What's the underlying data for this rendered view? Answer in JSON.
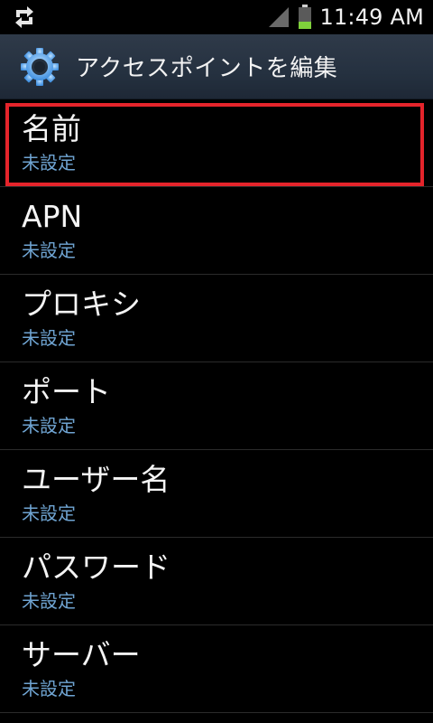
{
  "status_bar": {
    "time": "11:49 AM",
    "sync_icon": "sync-icon",
    "signal_icon": "signal-icon",
    "battery_icon": "battery-icon"
  },
  "header": {
    "icon": "settings-icon",
    "title": "アクセスポイントを編集"
  },
  "preferences": [
    {
      "title": "名前",
      "summary": "未設定"
    },
    {
      "title": "APN",
      "summary": "未設定"
    },
    {
      "title": "プロキシ",
      "summary": "未設定"
    },
    {
      "title": "ポート",
      "summary": "未設定"
    },
    {
      "title": "ユーザー名",
      "summary": "未設定"
    },
    {
      "title": "パスワード",
      "summary": "未設定"
    },
    {
      "title": "サーバー",
      "summary": "未設定"
    }
  ],
  "colors": {
    "summary_text": "#6fa4d2",
    "highlight_box": "#e5242b",
    "battery_level": "#7fd13b"
  }
}
